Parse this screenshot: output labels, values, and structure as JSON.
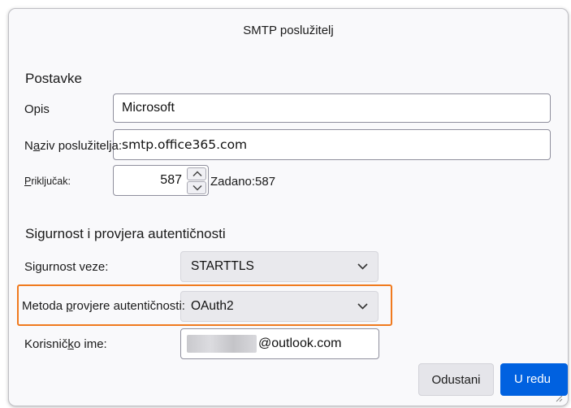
{
  "dialog": {
    "title": "SMTP poslužitelj"
  },
  "settings": {
    "section_title": "Postavke",
    "description_label": "Opis",
    "description_value": "Microsoft",
    "server_label_pre": "N",
    "server_label_accel": "a",
    "server_label_post": "ziv poslužitelja:",
    "server_value": "smtp.office365.com",
    "port_label_accel": "P",
    "port_label_post": "riključak:",
    "port_value": "587",
    "port_default": "Zadano:587"
  },
  "security": {
    "section_title": "Sigurnost i provjera autentičnosti",
    "connection_label": "Sigurnost veze:",
    "connection_value": "STARTTLS",
    "auth_label_pre": "Metoda ",
    "auth_label_accel": "p",
    "auth_label_post": "rovjere autentičnosti:",
    "auth_value": "OAuth2",
    "username_label_pre": "Korisnič",
    "username_label_accel": "k",
    "username_label_post": "o ime:",
    "username_domain": "@outlook.com"
  },
  "buttons": {
    "cancel": "Odustani",
    "ok": "U redu"
  },
  "colors": {
    "primary": "#0061e0",
    "highlight": "#f07a1e"
  }
}
